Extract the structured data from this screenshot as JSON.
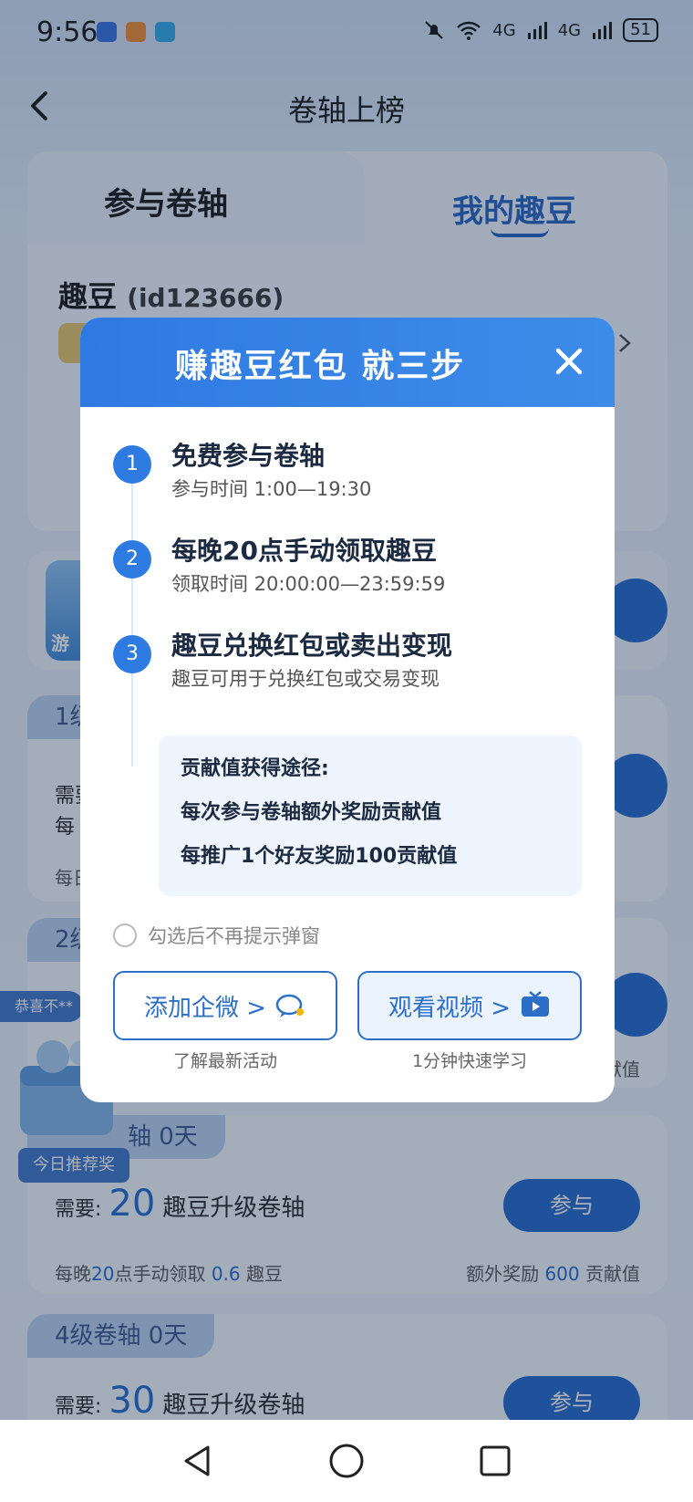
{
  "status": {
    "time": "9:56",
    "signal_1": "4G",
    "signal_2": "4G",
    "battery": "51"
  },
  "header": {
    "title": "卷轴上榜"
  },
  "tabs": {
    "left": "参与卷轴",
    "right": "我的趣豆"
  },
  "user": {
    "name": "趣豆",
    "id": "(id123666)"
  },
  "bg_cards": {
    "card1_tag": "1级",
    "card1_need1": "需要",
    "card1_need2": "每",
    "card1_foot": "每日",
    "card2_tag": "2级",
    "card2_right": "献值",
    "card3_tag": "轴 0天",
    "card3_need_label": "需要:",
    "card3_num": "20",
    "card3_text": "趣豆升级卷轴",
    "card3_btn": "参与",
    "card3_foot_a": "每晚",
    "card3_foot_b": "20",
    "card3_foot_c": "点手动领取",
    "card3_foot_d": "0.6",
    "card3_foot_e": "趣豆",
    "card3_foot_f": "额外奖励",
    "card3_foot_g": "600",
    "card3_foot_h": "贡献值",
    "card4_tag": "4级卷轴 0天",
    "card4_need_label": "需要:",
    "card4_num": "30",
    "card4_text": "趣豆升级卷轴",
    "card4_btn": "参与",
    "game_label": "游"
  },
  "floating": {
    "bubble": "恭喜不**",
    "gift_tag": "今日推荐奖"
  },
  "modal": {
    "title": "赚趣豆红包 就三步",
    "steps": [
      {
        "num": "1",
        "title": "免费参与卷轴",
        "sub": "参与时间 1:00—19:30"
      },
      {
        "num": "2",
        "title": "每晚20点手动领取趣豆",
        "sub": "领取时间 20:00:00—23:59:59"
      },
      {
        "num": "3",
        "title": "趣豆兑换红包或卖出变现",
        "sub": "趣豆可用于兑换红包或交易变现"
      }
    ],
    "contrib": {
      "title": "贡献值获得途径:",
      "line1": "每次参与卷轴额外奖励贡献值",
      "line2": "每推广1个好友奖励100贡献值"
    },
    "checkbox_label": "勾选后不再提示弹窗",
    "btn_left": "添加企微 >",
    "btn_left_sub": "了解最新活动",
    "btn_right": "观看视频 >",
    "btn_right_sub": "1分钟快速学习"
  },
  "colors": {
    "primary": "#2d7be0",
    "accent_text": "#1f66cc"
  }
}
